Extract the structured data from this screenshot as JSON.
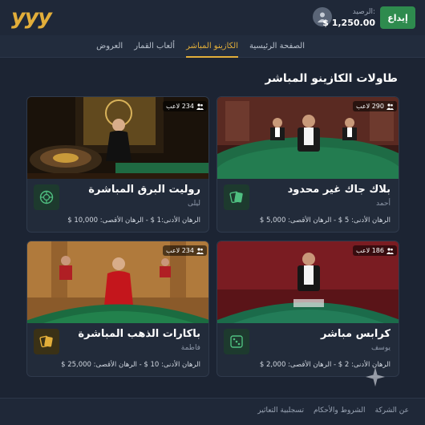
{
  "header": {
    "logo": "yyy",
    "balance_label": "الرصيد:",
    "balance_value": "$ 1,250.00",
    "deposit_label": "إيداع"
  },
  "nav": {
    "items": [
      {
        "label": "الصفحة الرئيسية",
        "active": false
      },
      {
        "label": "الكازينو المباشر",
        "active": true
      },
      {
        "label": "ألعاب القمار",
        "active": false
      },
      {
        "label": "العروض",
        "active": false
      }
    ]
  },
  "section_title": "طاولات الكازينو المباشر",
  "tables": [
    {
      "title": "بلاك جاك غير محدود",
      "dealer": "أحمد",
      "players": "290 لاعب",
      "limits": "الرهان الأدنى: 5 $ - الرهان الأقصى: 5,000 $",
      "icon": "cards-icon"
    },
    {
      "title": "روليت البرق المباشرة",
      "dealer": "ليلى",
      "players": "234 لاعب",
      "limits": "الرهان الأدنى:1 $ - الرهان الأقصى: 10,000 $",
      "icon": "roulette-icon"
    },
    {
      "title": "كرابس مباشر",
      "dealer": "يوسف",
      "players": "186 لاعب",
      "limits": "الرهان الأدنى: 2 $ - الرهان الأقصى: 2,000 $",
      "icon": "dice-icon"
    },
    {
      "title": "باكارات الذهب المباشرة",
      "dealer": "فاطمة",
      "players": "234 لاعب",
      "limits": "الرهان الأدنى: 10 $ - الرهان الأقصى: 25,000 $",
      "icon": "cards-icon"
    }
  ],
  "footer": {
    "links": [
      "عن الشركة",
      "الشروط والأحكام",
      "تسجلبية التعاثير"
    ]
  },
  "colors": {
    "accent": "#e2ae3a",
    "deposit": "#2e8b4e",
    "background": "#1c2433"
  }
}
